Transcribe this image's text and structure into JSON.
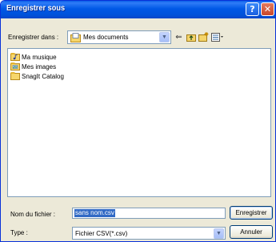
{
  "window": {
    "title": "Enregistrer sous",
    "help_glyph": "?",
    "close_glyph": "✕"
  },
  "lookin": {
    "label": "Enregistrer dans :",
    "value": "Mes documents",
    "arrow": "▼"
  },
  "toolbar": {
    "back_glyph": "⇐",
    "up_glyph": "⬑",
    "new_folder_glyph": "✱",
    "view_glyph": "▦▾"
  },
  "files": [
    {
      "name": "Ma musique",
      "icon": "music-folder-icon"
    },
    {
      "name": "Mes images",
      "icon": "pictures-folder-icon"
    },
    {
      "name": "SnagIt Catalog",
      "icon": "folder-icon"
    }
  ],
  "filename": {
    "label": "Nom du fichier :",
    "value": "sans nom.csv"
  },
  "filetype": {
    "label": "Type :",
    "value": "Fichier CSV(*.csv)",
    "arrow": "▼"
  },
  "buttons": {
    "save": "Enregistrer",
    "cancel": "Annuler"
  },
  "colors": {
    "titlebar": "#0058e6",
    "selection": "#316ac5",
    "dialog_bg": "#ece9d8"
  }
}
